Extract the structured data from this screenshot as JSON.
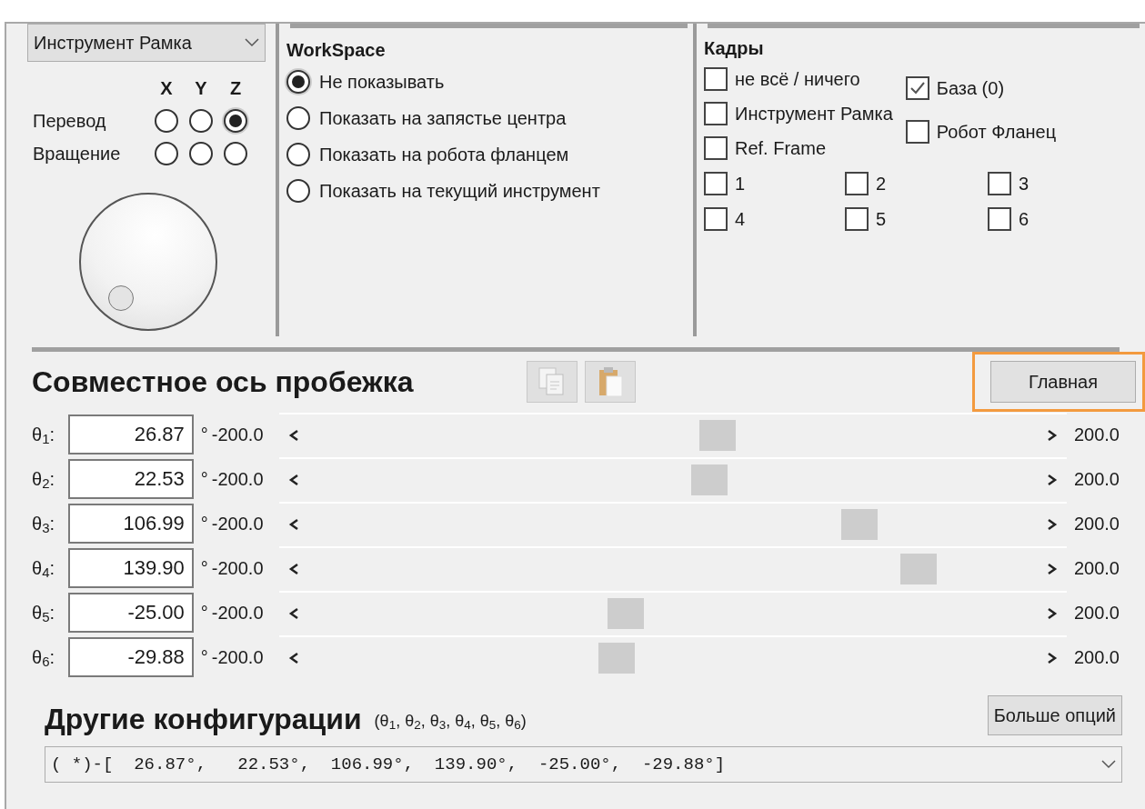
{
  "tool_dropdown": {
    "value": "Инструмент Рамка"
  },
  "axes": {
    "columns": [
      "X",
      "Y",
      "Z"
    ],
    "rows": [
      {
        "label": "Перевод",
        "options": [
          {
            "selected": false
          },
          {
            "selected": false
          },
          {
            "selected": true
          }
        ]
      },
      {
        "label": "Вращение",
        "options": [
          {
            "selected": false
          },
          {
            "selected": false
          },
          {
            "selected": false
          }
        ]
      }
    ]
  },
  "workspace": {
    "title": "WorkSpace",
    "options": [
      {
        "label": "Не показывать",
        "selected": true
      },
      {
        "label": "Показать на запястье центра",
        "selected": false
      },
      {
        "label": "Показать на робота фланцем",
        "selected": false
      },
      {
        "label": "Показать на текущий инструмент",
        "selected": false
      }
    ]
  },
  "frames": {
    "title": "Кадры",
    "items": [
      {
        "label": "не всё / ничего",
        "checked": false
      },
      {
        "label": "Инструмент Рамка",
        "checked": false
      },
      {
        "label": "Ref. Frame",
        "checked": false
      }
    ],
    "side_items": [
      {
        "label": "База (0)",
        "checked": true
      },
      {
        "label": "Робот Фланец",
        "checked": false
      }
    ],
    "numbered": [
      {
        "label": "1",
        "checked": false
      },
      {
        "label": "2",
        "checked": false
      },
      {
        "label": "3",
        "checked": false
      },
      {
        "label": "4",
        "checked": false
      },
      {
        "label": "5",
        "checked": false
      },
      {
        "label": "6",
        "checked": false
      }
    ]
  },
  "joint_jog": {
    "title": "Совместное ось пробежка",
    "home_button": {
      "label": "Главная",
      "highlighted": true
    },
    "joints": [
      {
        "label": "θ$_{1}$:",
        "value": "26.87",
        "unit": "°",
        "min": "-200.0",
        "max": "200.0",
        "level": 0.567
      },
      {
        "label": "θ$_{2}$:",
        "value": "22.53",
        "unit": "°",
        "min": "-200.0",
        "max": "200.0",
        "level": 0.556
      },
      {
        "label": "θ$_{3}$:",
        "value": "106.99",
        "unit": "°",
        "min": "-200.0",
        "max": "200.0",
        "level": 0.767
      },
      {
        "label": "θ$_{4}$:",
        "value": "139.90",
        "unit": "°",
        "min": "-200.0",
        "max": "200.0",
        "level": 0.85
      },
      {
        "label": "θ$_{5}$:",
        "value": "-25.00",
        "unit": "°",
        "min": "-200.0",
        "max": "200.0",
        "level": 0.4375
      },
      {
        "label": "θ$_{6}$:",
        "value": "-29.88",
        "unit": "°",
        "min": "-200.0",
        "max": "200.0",
        "level": 0.425
      }
    ]
  },
  "other_configs": {
    "title": "Другие конфигурации",
    "subtitle": "(θ$_{1}$, θ$_{2}$, θ$_{3}$, θ$_{4}$, θ$_{5}$, θ$_{6}$)",
    "more_button": "Больше опций",
    "selection": "( *)-[  26.87°,   22.53°,  106.99°,  139.90°,  -25.00°,  -29.88°]"
  }
}
